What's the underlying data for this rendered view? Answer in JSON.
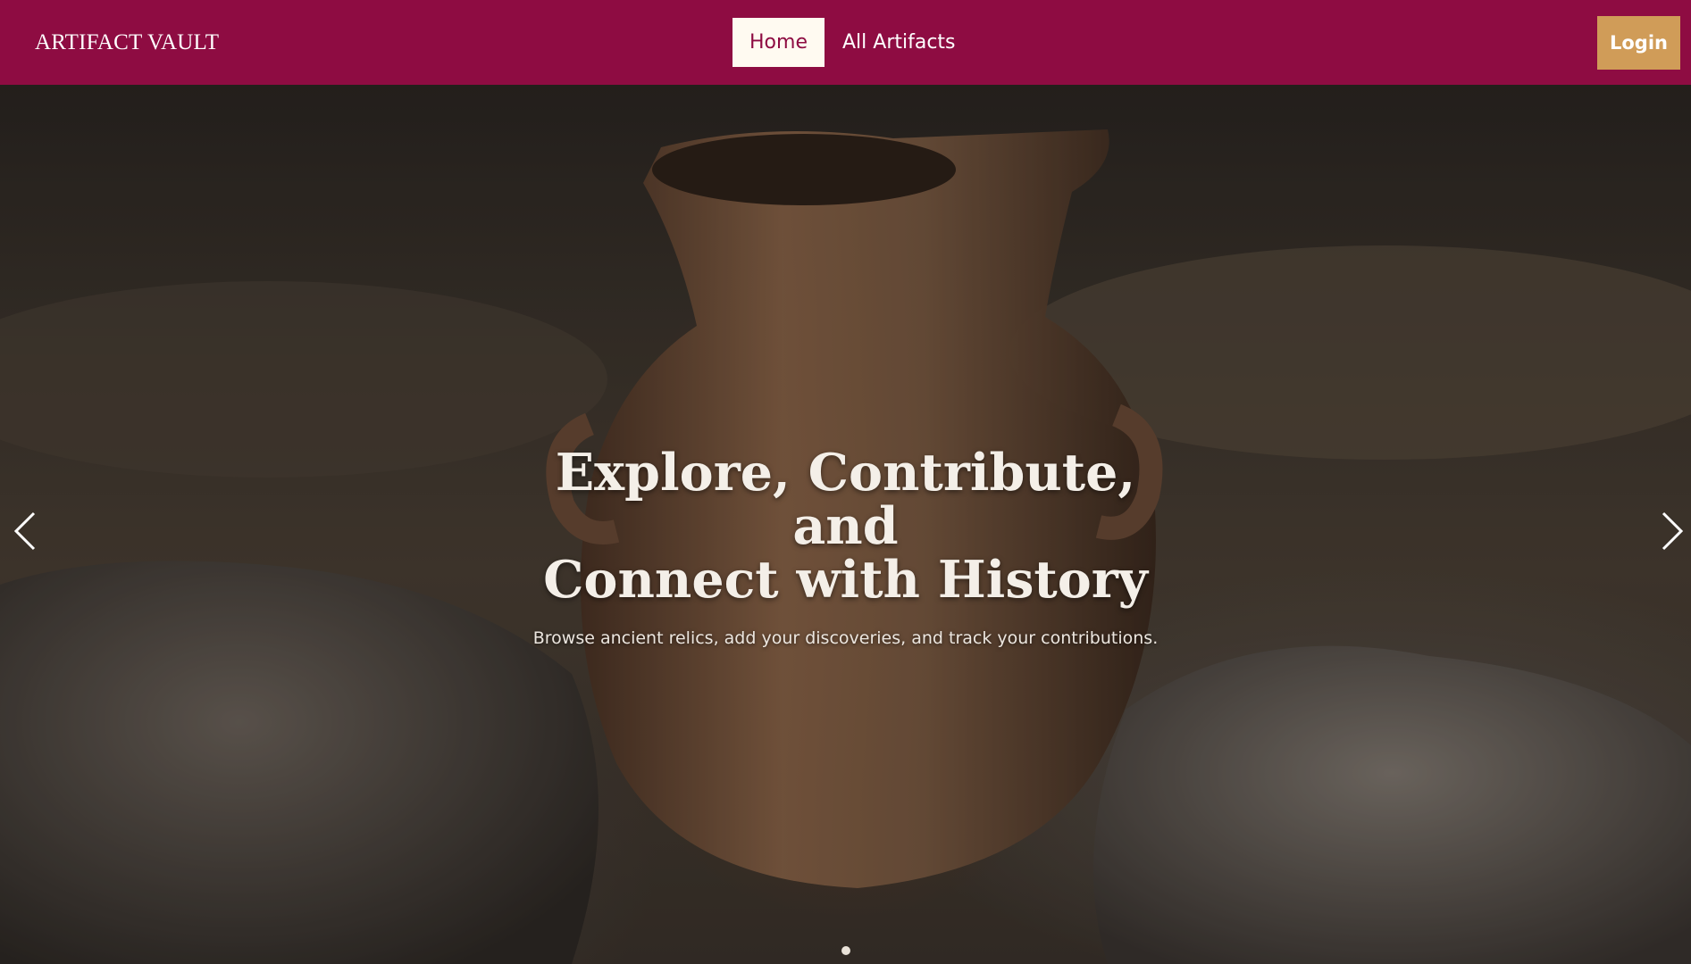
{
  "navbar": {
    "brand": "ARTIFACT VAULT",
    "links": [
      {
        "label": "Home",
        "active": true
      },
      {
        "label": "All Artifacts",
        "active": false
      }
    ],
    "login_label": "Login",
    "colors": {
      "background": "#8e0c42",
      "active_link_bg": "#fffaf1",
      "login_bg": "#d09c58"
    }
  },
  "hero": {
    "title_line1": "Explore, Contribute, and",
    "title_line2": "Connect with History",
    "subtitle": "Browse ancient relics, add your discoveries, and track your contributions.",
    "background_image": "ancient clay jug among stones",
    "icons": {
      "prev": "chevron-left-icon",
      "next": "chevron-right-icon"
    },
    "slides_count": 1,
    "active_slide": 1
  }
}
